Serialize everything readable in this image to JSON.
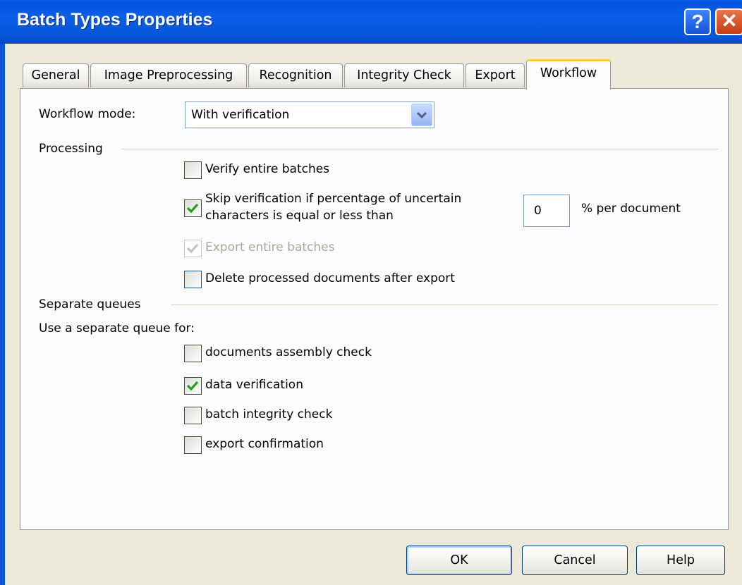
{
  "window": {
    "title": "Batch Types Properties",
    "help_icon": "question-mark-icon",
    "close_icon": "close-x-icon"
  },
  "tabs": [
    {
      "label": "General"
    },
    {
      "label": "Image Preprocessing"
    },
    {
      "label": "Recognition"
    },
    {
      "label": "Integrity Check"
    },
    {
      "label": "Export"
    },
    {
      "label": "Workflow",
      "active": true
    }
  ],
  "workflow": {
    "mode_label": "Workflow mode:",
    "mode_value": "With verification",
    "processing_header": "Processing",
    "verify_entire": {
      "label": "Verify entire batches",
      "checked": false
    },
    "skip_verification": {
      "label_line1": "Skip verification if percentage of uncertain",
      "label_line2": "characters is equal or less than",
      "checked": true,
      "value": "0",
      "unit": "% per document"
    },
    "export_entire": {
      "label": "Export entire batches",
      "checked": true,
      "disabled": true
    },
    "delete_processed": {
      "label": "Delete processed documents after export",
      "checked": false
    },
    "queues_header": "Separate queues",
    "queues_intro": "Use a separate queue for:",
    "queues": [
      {
        "label": "documents assembly check",
        "checked": false
      },
      {
        "label": "data verification",
        "checked": true
      },
      {
        "label": "batch integrity check",
        "checked": false
      },
      {
        "label": "export confirmation",
        "checked": false
      }
    ]
  },
  "buttons": {
    "ok": "OK",
    "cancel": "Cancel",
    "help": "Help"
  },
  "colors": {
    "titlebar": "#0454de",
    "check": "#21a121",
    "dialog_bg": "#ece9d8"
  }
}
